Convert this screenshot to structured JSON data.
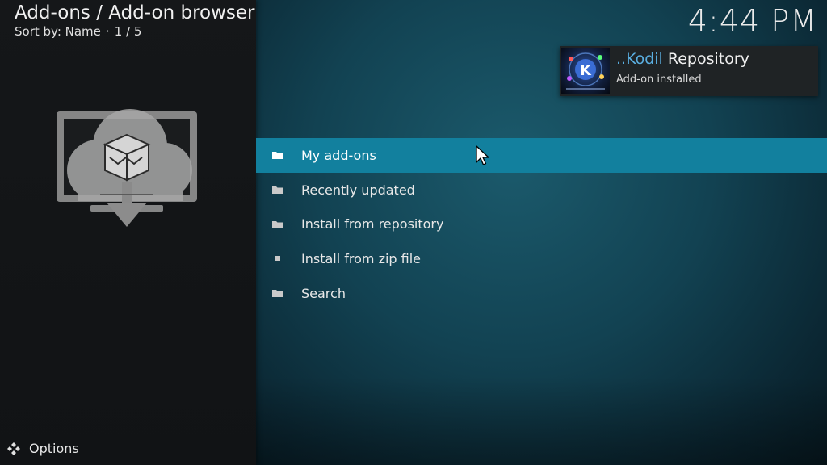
{
  "header": {
    "title": "Add-ons / Add-on browser",
    "sort_label": "Sort by: Name",
    "separator": "·",
    "position": "1 / 5"
  },
  "clock": {
    "time": "4:44 PM"
  },
  "notification": {
    "accent_text": "..Kodil",
    "title_rest": "Repository",
    "message": "Add-on installed",
    "thumb_icon": "kodil-repository-logo"
  },
  "menu": {
    "items": [
      {
        "label": "My add-ons",
        "icon": "folder-icon",
        "focused": true
      },
      {
        "label": "Recently updated",
        "icon": "folder-icon",
        "focused": false
      },
      {
        "label": "Install from repository",
        "icon": "folder-icon",
        "focused": false
      },
      {
        "label": "Install from zip file",
        "icon": "file-icon",
        "focused": false
      },
      {
        "label": "Search",
        "icon": "folder-icon",
        "focused": false
      }
    ]
  },
  "hero": {
    "icon": "addon-browser-icon"
  },
  "footer": {
    "options_label": "Options",
    "icon": "options-diamond-icon"
  },
  "colors": {
    "focus": "#12809e",
    "accent": "#5aaee0",
    "left_panel": "#151719"
  }
}
